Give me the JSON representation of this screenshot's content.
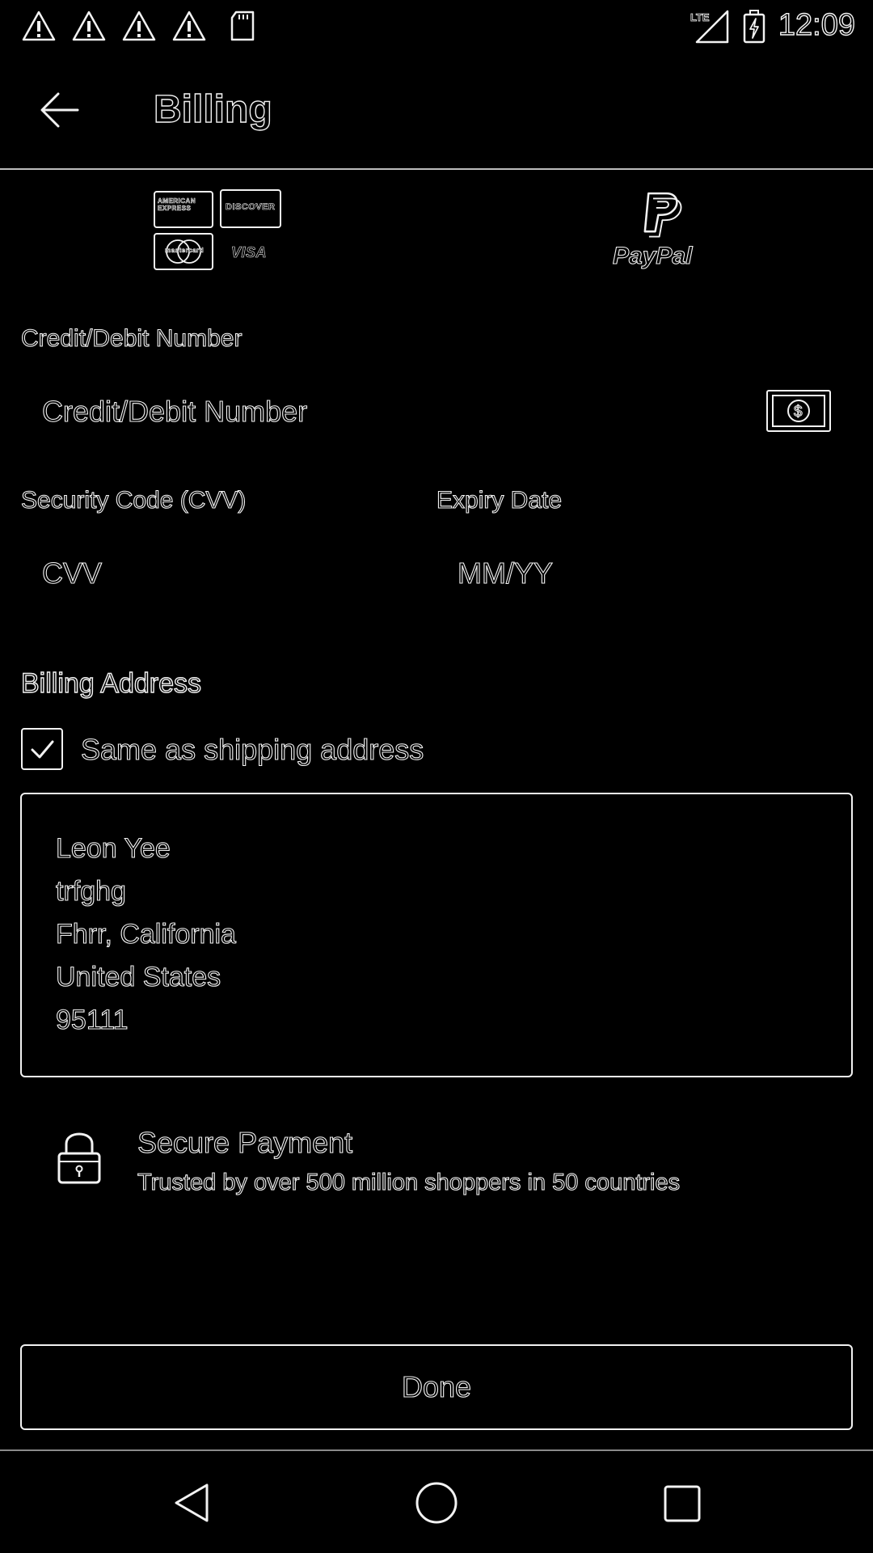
{
  "status_bar": {
    "time": "12:09",
    "icons": [
      "warning-icon",
      "warning-icon",
      "warning-icon",
      "warning-icon",
      "sd-card-icon",
      "lte-signal-icon",
      "battery-charging-icon"
    ]
  },
  "app_bar": {
    "title": "Billing",
    "back_icon": "arrow-back-icon"
  },
  "payment_methods": {
    "cards_tab": {
      "icon": "credit-cards-icon",
      "cards": [
        "AMERICAN EXPRESS",
        "DISCOVER",
        "mastercard",
        "VISA"
      ]
    },
    "paypal_tab": {
      "icon": "paypal-icon",
      "label": "PayPal"
    }
  },
  "card_number": {
    "label": "Credit/Debit Number",
    "placeholder": "Credit/Debit Number",
    "scan_icon": "dollar-bill-icon"
  },
  "cvv": {
    "label": "Security Code (CVV)",
    "placeholder": "CVV"
  },
  "expiry": {
    "label": "Expiry Date",
    "placeholder": "MM/YY"
  },
  "billing_address": {
    "heading": "Billing Address",
    "same_as_shipping_label": "Same as shipping address",
    "same_as_shipping_checked": true,
    "lines": [
      "Leon Yee",
      "trfghg",
      "Fhrr, California",
      "United States",
      "95111"
    ]
  },
  "secure_payment": {
    "icon": "lock-icon",
    "title": "Secure Payment",
    "subtitle": "Trusted by over 500 million shoppers in 50 countries"
  },
  "done_button": {
    "label": "Done"
  },
  "nav_bar": {
    "back": "nav-back-icon",
    "home": "nav-home-icon",
    "recents": "nav-recents-icon"
  },
  "colors": {
    "background": "#000000",
    "outline": "#f2f2f2"
  }
}
